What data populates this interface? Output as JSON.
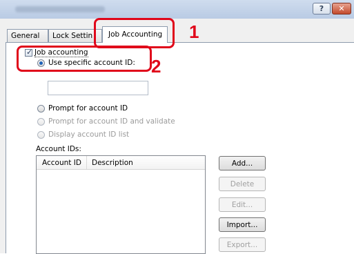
{
  "window": {
    "help_label": "?",
    "close_label": "✕"
  },
  "tabs": [
    {
      "label": "General"
    },
    {
      "label": "Lock Settin"
    },
    {
      "label": "Job Accounting"
    }
  ],
  "job_accounting": {
    "checkbox_label": "Job accounting",
    "checked": true,
    "use_specific_label": "Use specific account ID:",
    "account_id_value": "",
    "options": [
      {
        "label": "Prompt for account ID",
        "enabled": true
      },
      {
        "label": "Prompt for account ID and validate",
        "enabled": false
      },
      {
        "label": "Display account ID list",
        "enabled": false
      }
    ],
    "account_ids_label": "Account IDs:",
    "columns": [
      "Account ID",
      "Description"
    ],
    "buttons": [
      {
        "label": "Add...",
        "enabled": true
      },
      {
        "label": "Delete",
        "enabled": false
      },
      {
        "label": "Edit...",
        "enabled": false
      },
      {
        "label": "Import...",
        "enabled": true
      },
      {
        "label": "Export...",
        "enabled": false
      }
    ]
  },
  "annotations": {
    "callout_1": "1",
    "callout_2": "2",
    "color": "#e0061a"
  }
}
